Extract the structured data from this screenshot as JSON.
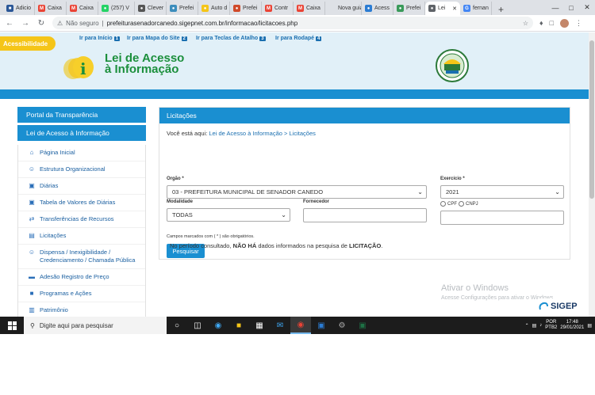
{
  "browser": {
    "tabs": [
      {
        "label": "Adicio",
        "color": "#2b5797",
        "glyph": "■"
      },
      {
        "label": "Caixa",
        "color": "#ea4335",
        "glyph": "M"
      },
      {
        "label": "Caixa",
        "color": "#ea4335",
        "glyph": "M"
      },
      {
        "label": "(257) V",
        "color": "#25d366",
        "glyph": "●"
      },
      {
        "label": "Clever",
        "color": "#555555",
        "glyph": "●"
      },
      {
        "label": "Prefei",
        "color": "#3c8dbc",
        "glyph": "●"
      },
      {
        "label": "Auto d",
        "color": "#f5c518",
        "glyph": "●"
      },
      {
        "label": "Prefei",
        "color": "#d04a2a",
        "glyph": "●"
      },
      {
        "label": "Contr",
        "color": "#ea4335",
        "glyph": "M"
      },
      {
        "label": "Caixa",
        "color": "#ea4335",
        "glyph": "M"
      },
      {
        "label": "Nova guia",
        "color": "#dee1e6",
        "glyph": ""
      },
      {
        "label": "Acess",
        "color": "#2b7cd3",
        "glyph": "●"
      },
      {
        "label": "Prefei",
        "color": "#3a9a5a",
        "glyph": "●"
      },
      {
        "label": "Lei",
        "color": "#5f6368",
        "glyph": "●"
      },
      {
        "label": "fernan",
        "color": "#4285f4",
        "glyph": "G"
      }
    ],
    "active_tab_index": 13,
    "security_label": "Não seguro",
    "url": "prefeiturasenadorcanedo.sigepnet.com.br/informacao/licitacoes.php"
  },
  "header": {
    "accessibility_label": "Acessibilidade",
    "skip_links": [
      {
        "label": "Ir para Início",
        "num": "1"
      },
      {
        "label": "Ir para Mapa do Site",
        "num": "2"
      },
      {
        "label": "Ir para Teclas de Atalho",
        "num": "3"
      },
      {
        "label": "Ir para Rodapé",
        "num": "4"
      }
    ],
    "logo_line1": "Lei de Acesso",
    "logo_line2": "à Informação",
    "logo_letter": "i"
  },
  "sidebar": {
    "portal_label": "Portal da Transparência",
    "section_label": "Lei de Acesso à Informação",
    "items": [
      {
        "label": "Página Inicial",
        "icon": "home-icon",
        "glyph": "⌂"
      },
      {
        "label": "Estrutura Organizacional",
        "icon": "people-icon",
        "glyph": "☺"
      },
      {
        "label": "Diárias",
        "icon": "briefcase-icon",
        "glyph": "▣"
      },
      {
        "label": "Tabela de Valores de Diárias",
        "icon": "briefcase-icon",
        "glyph": "▣"
      },
      {
        "label": "Transferências de Recursos",
        "icon": "transfer-icon",
        "glyph": "⇄"
      },
      {
        "label": "Licitações",
        "icon": "document-icon",
        "glyph": "▤"
      },
      {
        "label": "Dispensa / Inexigibilidade / Credenciamento / Chamada Pública",
        "icon": "users-icon",
        "glyph": "☺"
      },
      {
        "label": "Adesão Registro de Preço",
        "icon": "card-icon",
        "glyph": "▬"
      },
      {
        "label": "Programas e Ações",
        "icon": "folder-icon",
        "glyph": "■"
      },
      {
        "label": "Patrimônio",
        "icon": "building-icon",
        "glyph": "▥"
      }
    ]
  },
  "main": {
    "title": "Licitações",
    "breadcrumb_prefix": "Você está aqui:",
    "breadcrumb_link": "Lei de Acesso à Informação",
    "breadcrumb_sep": ">",
    "breadcrumb_current": "Licitações",
    "orgao_label": "Orgão *",
    "orgao_value": "03 - PREFEITURA MUNICIPAL DE SENADOR CANEDO",
    "exercicio_label": "Exercício *",
    "exercicio_value": "2021",
    "modalidade_label": "Modalidade",
    "modalidade_value": "TODAS",
    "fornecedor_label": "Fornecedor",
    "fornecedor_value": "",
    "cpf_label": "CPF",
    "cnpj_label": "CNPJ",
    "required_note": "Campos marcados com ( * ) são obrigatórios.",
    "search_button": "Pesquisar",
    "result_prefix": "No período consultado,",
    "result_strong": "NÃO HÁ",
    "result_middle": "dados informados na pesquisa de",
    "result_strong2": "LICITAÇÃO",
    "result_end": "."
  },
  "watermark": {
    "title": "Ativar o Windows",
    "subtitle": "Acesse Configurações para ativar o Windows."
  },
  "sigep_logo": "SIGEP",
  "taskbar": {
    "search_placeholder": "Digite aqui para pesquisar",
    "lang_line1": "POR",
    "lang_line2": "PTB2",
    "time": "17:48",
    "date": "29/01/2021"
  },
  "colors": {
    "accent_blue": "#1a8fd1",
    "header_bg": "#e1f0f8",
    "logo_green": "#1b8f3c",
    "badge_yellow": "#f5c518"
  }
}
